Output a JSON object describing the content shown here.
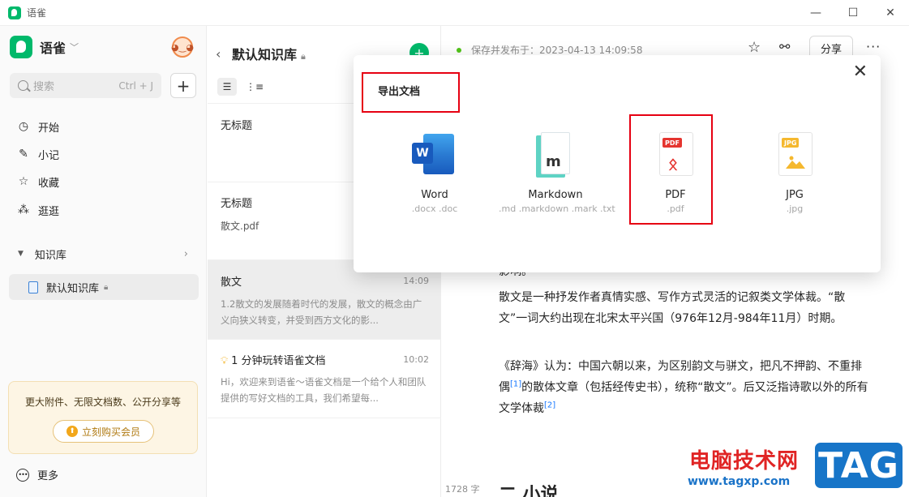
{
  "window": {
    "title": "语雀",
    "controls": [
      "—",
      "☐",
      "✕"
    ]
  },
  "sidebar": {
    "brand": "语雀",
    "search": {
      "placeholder": "搜索",
      "shortcut": "Ctrl + J"
    },
    "nav": [
      {
        "label": "开始",
        "icon": "clock-icon"
      },
      {
        "label": "小记",
        "icon": "feather-icon"
      },
      {
        "label": "收藏",
        "icon": "star-icon"
      },
      {
        "label": "逛逛",
        "icon": "grid-icon"
      }
    ],
    "knowledge_base_section": "知识库",
    "knowledge_base_item": "默认知识库",
    "promo": {
      "text": "更大附件、无限文档数、公开分享等",
      "button": "立刻购买会员"
    },
    "more": "更多"
  },
  "doclist": {
    "title": "默认知识库",
    "docs": [
      {
        "title": "无标题"
      },
      {
        "title": "无标题",
        "sub": "散文.pdf"
      },
      {
        "title": "散文",
        "time": "14:09",
        "excerpt": "1.2散文的发展随着时代的发展，散文的概念由广义向狭义转变，并受到西方文化的影..."
      },
      {
        "title": "1 分钟玩转语雀文档",
        "time": "10:02",
        "excerpt": "Hi，欢迎来到语雀～语雀文档是一个给个人和团队提供的写好文档的工具，我们希望每..."
      }
    ]
  },
  "editor": {
    "status": "保存并发布于：2023-04-13 14:09:58",
    "share": "分享",
    "p0_tail": "影响。",
    "p1": "散文是一种抒发作者真情实感、写作方式灵活的记叙类文学体裁。“散文”一词大约出现在北宋太平兴国（976年12月-984年11月）时期。",
    "p2a": "《辞海》认为：中国六朝以来，为区别韵文与骈文，把凡不押韵、不重排偶",
    "ref1": "[1]",
    "p2b": "的散体文章（包括经传史书），统称“散文”。后又泛指诗歌以外的所有文学体裁",
    "ref2": "[2]",
    "word_count": "1728 字",
    "heading_peek": "二 小说"
  },
  "modal": {
    "title": "导出文档",
    "formats": [
      {
        "name": "Word",
        "ext": ".docx .doc",
        "icon": "word-icon"
      },
      {
        "name": "Markdown",
        "ext": ".md .markdown .mark .txt",
        "icon": "markdown-icon"
      },
      {
        "name": "PDF",
        "ext": ".pdf",
        "icon": "pdf-icon",
        "tag": "PDF"
      },
      {
        "name": "JPG",
        "ext": ".jpg",
        "icon": "jpg-icon",
        "tag": "JPG"
      }
    ]
  },
  "watermark": {
    "text": "电脑技术网",
    "url": "www.tagxp.com",
    "badge": "TAG"
  },
  "colors": {
    "brand_green": "#00b96b",
    "highlight_red": "#e60012",
    "pdf_red": "#e5342f",
    "word_blue": "#185abd",
    "jpg_yellow": "#f5b82e"
  }
}
